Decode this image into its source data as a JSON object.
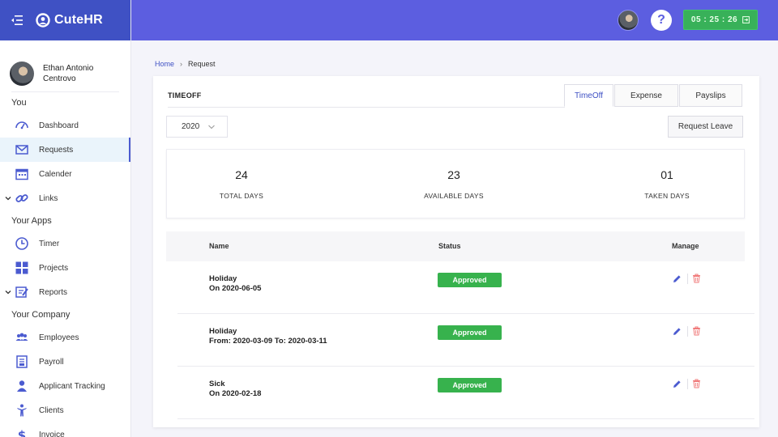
{
  "app": {
    "name": "CuteHR"
  },
  "user": {
    "name_line1": "Ethan Antonio",
    "name_line2": "Centrovo"
  },
  "sidebar": {
    "section_you": "You",
    "section_apps": "Your Apps",
    "section_company": "Your Company",
    "items": {
      "dashboard": "Dashboard",
      "requests": "Requests",
      "calender": "Calender",
      "links": "Links",
      "timer": "Timer",
      "projects": "Projects",
      "reports": "Reports",
      "employees": "Employees",
      "payroll": "Payroll",
      "applicant_tracking": "Applicant Tracking",
      "clients": "Clients",
      "invoice": "Invoice"
    }
  },
  "topbar": {
    "help_label": "?",
    "timer": "05 : 25 : 26"
  },
  "breadcrumb": {
    "home": "Home",
    "current": "Request"
  },
  "card": {
    "title": "TIMEOFF",
    "tabs": {
      "timeoff": "TimeOff",
      "expense": "Expense",
      "payslips": "Payslips"
    },
    "year": "2020",
    "request_button": "Request Leave",
    "stats": {
      "total": {
        "value": "24",
        "label": "TOTAL DAYS"
      },
      "available": {
        "value": "23",
        "label": "AVAILABLE DAYS"
      },
      "taken": {
        "value": "01",
        "label": "TAKEN DAYS"
      }
    },
    "table": {
      "headers": {
        "name": "Name",
        "status": "Status",
        "manage": "Manage"
      },
      "rows": [
        {
          "title": "Holiday",
          "date": "On 2020-06-05",
          "status": "Approved"
        },
        {
          "title": "Holiday",
          "date": "From: 2020-03-09 To: 2020-03-11",
          "status": "Approved"
        },
        {
          "title": "Sick",
          "date": "On 2020-02-18",
          "status": "Approved"
        }
      ]
    }
  },
  "colors": {
    "brand": "#3f51c4",
    "topbar": "#5c5ee0",
    "success": "#37b24d",
    "danger": "#f07a7a"
  }
}
